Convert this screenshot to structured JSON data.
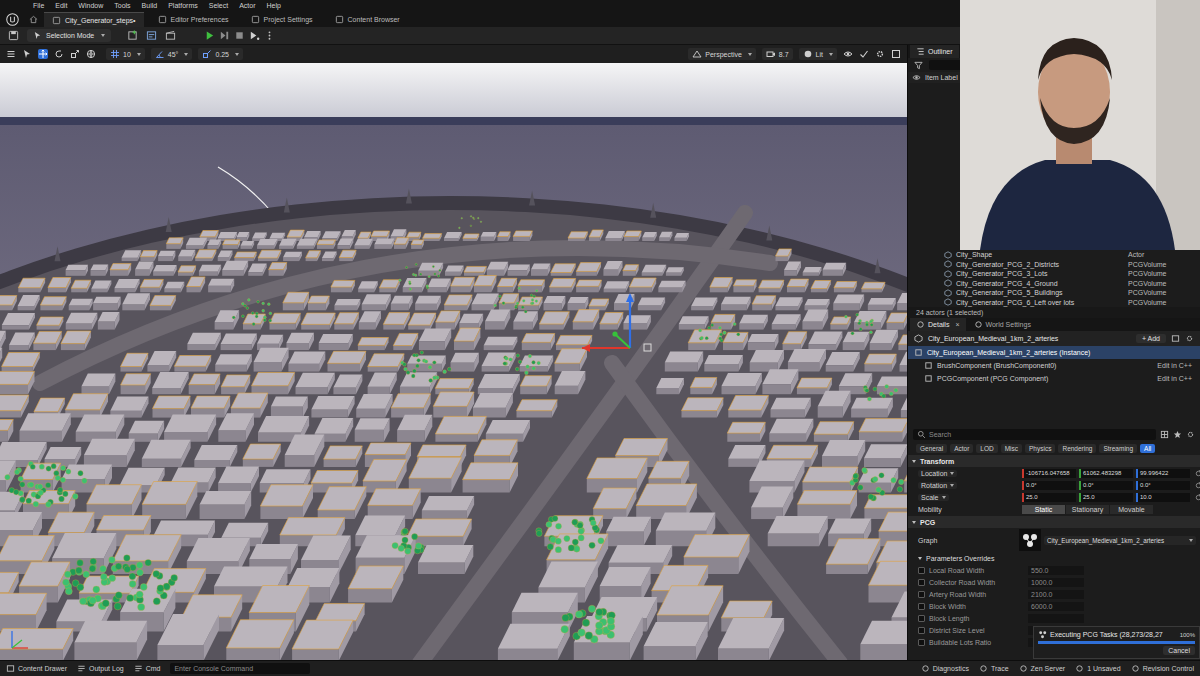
{
  "menu": [
    "File",
    "Edit",
    "Window",
    "Tools",
    "Build",
    "Platforms",
    "Select",
    "Actor",
    "Help"
  ],
  "doc_tabs": [
    {
      "label": "City_Generator_steps•",
      "selected": true
    },
    {
      "label": "Editor Preferences",
      "selected": false
    },
    {
      "label": "Project Settings",
      "selected": false
    },
    {
      "label": "Content Browser",
      "selected": false
    }
  ],
  "toolbar": {
    "mode": "Selection Mode"
  },
  "viewport": {
    "grid_snap": "10",
    "rotation_snap": "45°",
    "scale_snap": "0.25",
    "projection": "Perspective",
    "camera_speed": "8.7",
    "view_mode": "Lit"
  },
  "outliner": {
    "title": "Outliner",
    "column": "Item Label",
    "rows": [
      {
        "label": "City_Shape",
        "type": "Actor"
      },
      {
        "label": "City_Generator_PCG_2_Districts",
        "type": "PCGVolume"
      },
      {
        "label": "City_Generator_PCG_3_Lots",
        "type": "PCGVolume"
      },
      {
        "label": "City_Generator_PCG_4_Ground",
        "type": "PCGVolume"
      },
      {
        "label": "City_Generator_PCG_5_Buildings",
        "type": "PCGVolume"
      },
      {
        "label": "City_Generator_PCG_6_Left over lots",
        "type": "PCGVolume"
      }
    ],
    "footer": "24 actors (1 selected)"
  },
  "details": {
    "tabs": [
      {
        "label": "Details",
        "selected": true,
        "closable": true
      },
      {
        "label": "World Settings",
        "selected": false,
        "closable": false
      }
    ],
    "close_glyph": "×",
    "actor_name": "City_European_Medieval_1km_2_arteries",
    "add_button": "+ Add",
    "components": [
      {
        "label": "City_European_Medieval_1km_2_arteries (Instance)",
        "selected": true
      },
      {
        "label": "BrushComponent (BrushComponent0)",
        "action": "Edit in C++",
        "selected": false
      },
      {
        "label": "PCGComponent (PCG Component)",
        "action": "Edit in C++",
        "selected": false
      }
    ],
    "search_placeholder": "Search",
    "categories": [
      {
        "label": "General",
        "selected": false
      },
      {
        "label": "Actor",
        "selected": false
      },
      {
        "label": "LOD",
        "selected": false
      },
      {
        "label": "Misc",
        "selected": false
      },
      {
        "label": "Physics",
        "selected": false
      },
      {
        "label": "Rendering",
        "selected": false
      },
      {
        "label": "Streaming",
        "selected": false
      },
      {
        "label": "All",
        "selected": true
      }
    ],
    "transform": {
      "title": "Transform",
      "rows": [
        {
          "label": "Location",
          "values": [
            "-106716.047658",
            "61062.483298",
            "99.996422"
          ]
        },
        {
          "label": "Rotation",
          "values": [
            "0.0°",
            "0.0°",
            "0.0°"
          ]
        },
        {
          "label": "Scale",
          "values": [
            "25.0",
            "25.0",
            "10.0"
          ]
        }
      ]
    },
    "mobility": {
      "label": "Mobility",
      "options": [
        {
          "label": "Static",
          "selected": true
        },
        {
          "label": "Stationary",
          "selected": false
        },
        {
          "label": "Movable",
          "selected": false
        }
      ]
    },
    "pcg": {
      "title": "PCG",
      "graph_label": "Graph",
      "graph_value": "City_European_Medieval_1km_2_arteries",
      "overrides_title": "Parameters Overrides",
      "params": [
        {
          "label": "Local Road Width",
          "value": "550.0",
          "checked": false
        },
        {
          "label": "Collector Road Width",
          "value": "1000.0",
          "checked": false
        },
        {
          "label": "Artery Road Width",
          "value": "2100.0",
          "checked": false
        },
        {
          "label": "Block Width",
          "value": "6000.0",
          "checked": false
        },
        {
          "label": "Block Length",
          "checked": false
        },
        {
          "label": "District Size Level",
          "checked": false
        },
        {
          "label": "Buildable Lots Ratio",
          "checked": false
        }
      ]
    }
  },
  "notification": {
    "text": "Executing PCG Tasks (28,273/28,27",
    "percent": "100%",
    "level": 1,
    "button": "Cancel"
  },
  "status_bar": {
    "left": [
      "Content Drawer",
      "Output Log",
      "Cmd"
    ],
    "console_placeholder": "Enter Console Command",
    "right": [
      "Diagnostics",
      "Trace",
      "Zen Server",
      "1 Unsaved",
      "Revision Control"
    ]
  }
}
